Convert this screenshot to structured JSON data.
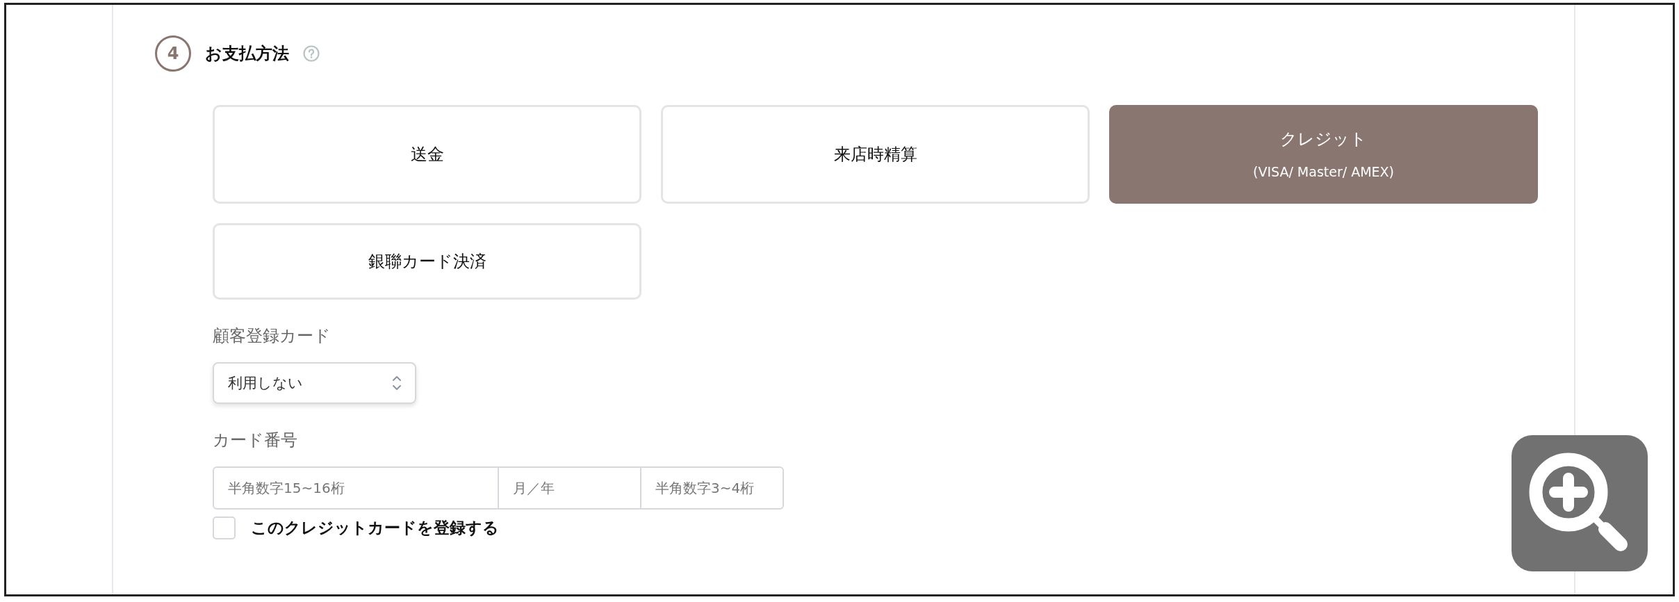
{
  "section": {
    "step": "4",
    "title": "お支払方法"
  },
  "payment_methods": [
    {
      "label": "送金",
      "selected": false
    },
    {
      "label": "来店時精算",
      "selected": false
    },
    {
      "label": "クレジット",
      "sublabel": "(VISA/ Master/ AMEX)",
      "selected": true
    },
    {
      "label": "銀聯カード決済",
      "selected": false
    }
  ],
  "saved_card": {
    "label": "顧客登録カード",
    "value": "利用しない"
  },
  "card_number": {
    "label": "カード番号",
    "fields": [
      {
        "placeholder": "半角数字15~16桁"
      },
      {
        "placeholder": "月／年"
      },
      {
        "placeholder": "半角数字3~4桁"
      }
    ]
  },
  "save_card": {
    "label": "このクレジットカードを登録する",
    "checked": false
  }
}
